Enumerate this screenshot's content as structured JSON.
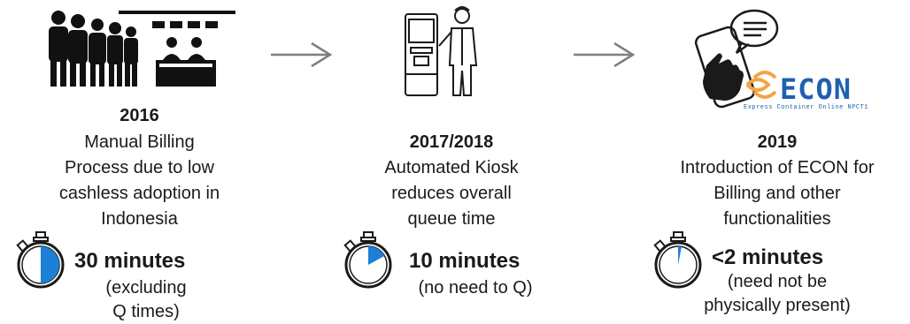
{
  "stages": [
    {
      "year": "2016",
      "description": [
        "Manual Billing",
        "Process due to low",
        "cashless adoption in",
        "Indonesia"
      ],
      "time": "30 minutes",
      "note": [
        "(excluding",
        "Q times)"
      ],
      "icon": "queue-people-counter-icon",
      "timer_fraction": 0.5
    },
    {
      "year": "2017/2018",
      "description": [
        "Automated Kiosk",
        "reduces overall",
        "queue time"
      ],
      "time": "10 minutes",
      "note": [
        "(no need to Q)"
      ],
      "icon": "kiosk-user-icon",
      "timer_fraction": 0.17
    },
    {
      "year": "2019",
      "description": [
        "Introduction of ECON for",
        "Billing and other",
        "functionalities"
      ],
      "time": "<2 minutes",
      "note": [
        "(need not be",
        "physically present)"
      ],
      "icon": "phone-chat-hand-icon",
      "timer_fraction": 0.03
    }
  ],
  "econ_logo": {
    "wordmark": "ECON",
    "tagline": "Express Container Online NPCT1"
  },
  "colors": {
    "accent_blue": "#1e7fd6",
    "logo_blue": "#1f5fb0",
    "logo_orange": "#f2a541",
    "arrow_gray": "#7f7f7f",
    "text": "#1a1a1a"
  }
}
